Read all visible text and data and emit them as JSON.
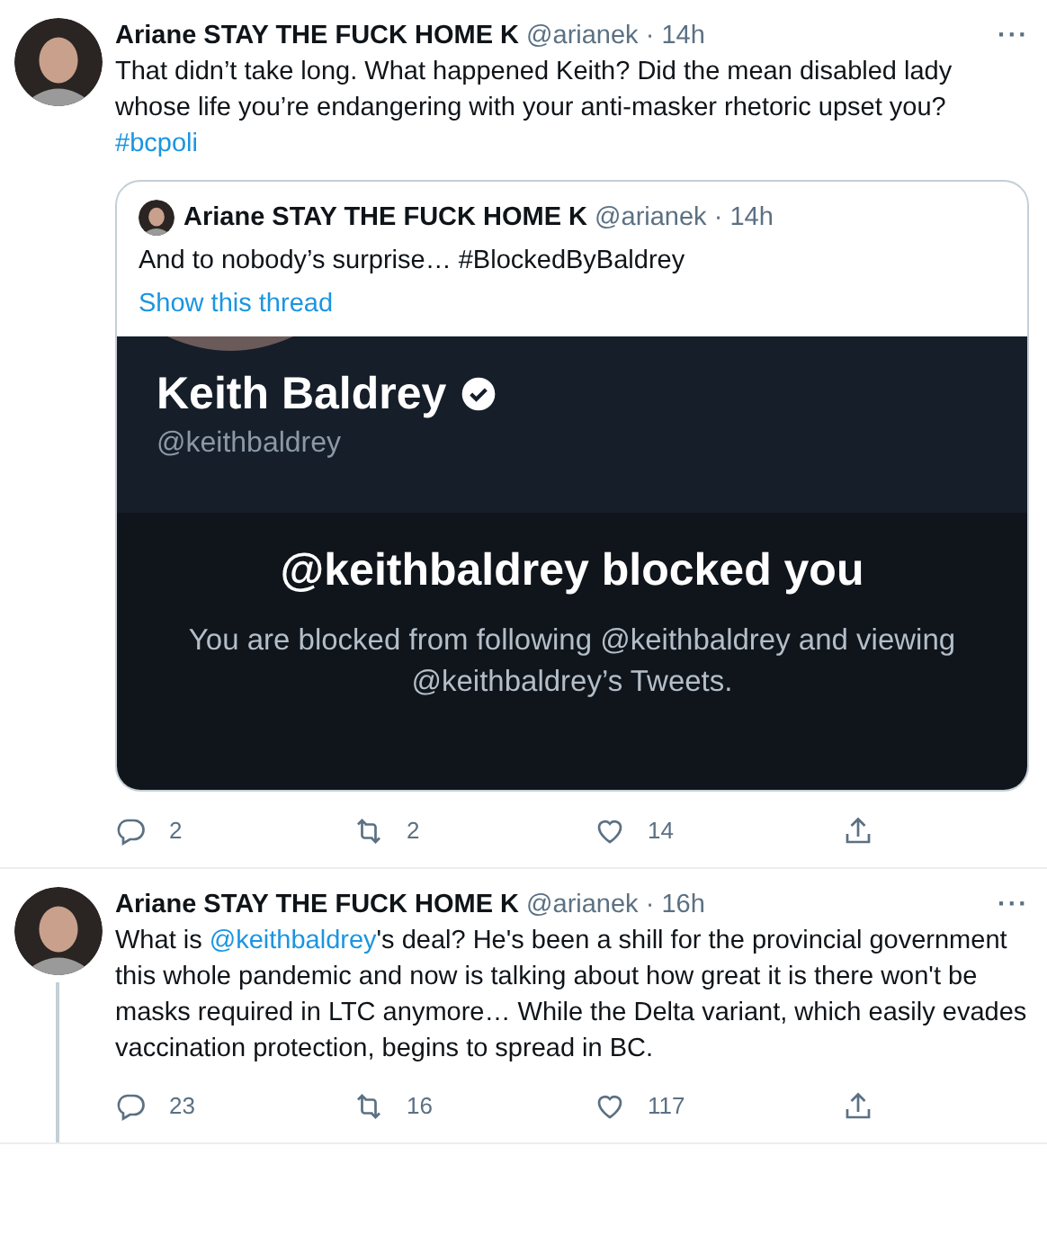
{
  "tweets": [
    {
      "author": "Ariane STAY THE FUCK HOME K",
      "handle": "@arianek",
      "separator": "·",
      "time": "14h",
      "more": "···",
      "thread_line": false,
      "text": [
        {
          "kind": "text",
          "text": "That didn’t take long. What happened Keith? Did the mean disabled lady whose life you’re endangering with your anti-masker rhetoric upset you? "
        },
        {
          "kind": "link",
          "text": "#bcpoli"
        }
      ],
      "quoted": {
        "author": "Ariane STAY THE FUCK HOME K",
        "handle": "@arianek",
        "separator": "·",
        "time": "14h",
        "text": "And to nobody’s surprise… #BlockedByBaldrey",
        "show_thread": "Show this thread",
        "screenshot": {
          "name": "Keith Baldrey",
          "verified": true,
          "handle": "@keithbaldrey",
          "title": "@keithbaldrey blocked you",
          "message": "You are blocked from following @keithbaldrey and viewing @keithbaldrey’s Tweets."
        }
      },
      "actions": [
        {
          "kind": "reply",
          "count": "2"
        },
        {
          "kind": "retweet",
          "count": "2"
        },
        {
          "kind": "like",
          "count": "14"
        },
        {
          "kind": "share"
        }
      ]
    },
    {
      "author": "Ariane STAY THE FUCK HOME K",
      "handle": "@arianek",
      "separator": "·",
      "time": "16h",
      "more": "···",
      "thread_line": true,
      "text": [
        {
          "kind": "text",
          "text": "What is "
        },
        {
          "kind": "link",
          "text": "@keithbaldrey"
        },
        {
          "kind": "text",
          "text": "'s deal? He's been a shill for the provincial government this whole pandemic and now is talking about how great it is there won't be masks required in LTC anymore… While the Delta variant, which easily evades vaccination protection, begins to spread in BC."
        }
      ],
      "actions": [
        {
          "kind": "reply",
          "count": "23"
        },
        {
          "kind": "retweet",
          "count": "16"
        },
        {
          "kind": "like",
          "count": "117"
        },
        {
          "kind": "share"
        }
      ]
    }
  ]
}
